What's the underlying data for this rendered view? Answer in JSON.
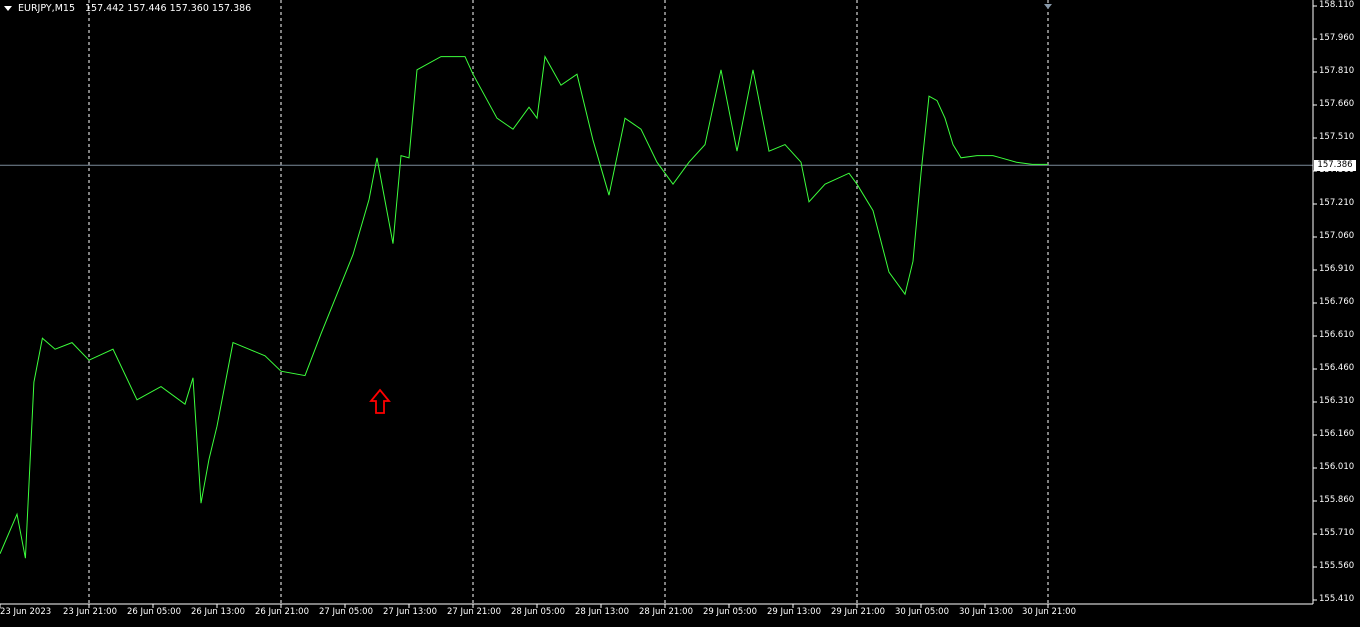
{
  "info": {
    "symbol": "EURJPY,M15",
    "ohlc": "157.442 157.446 157.360 157.386"
  },
  "colors": {
    "background": "#000000",
    "line": "#3cff3c",
    "grid": "#ffffff",
    "price_line": "#7a8a99",
    "arrow": "#ff0000"
  },
  "arrow_icon": "up-arrow-icon",
  "chart_data": {
    "type": "line",
    "current_price": "157.386",
    "y_ticks": [
      "158.110",
      "157.960",
      "157.810",
      "157.660",
      "157.510",
      "157.360",
      "157.210",
      "157.060",
      "156.910",
      "156.760",
      "156.610",
      "156.460",
      "156.310",
      "156.160",
      "156.010",
      "155.860",
      "155.710",
      "155.560",
      "155.410"
    ],
    "x_ticks": [
      "23 Jun 2023",
      "23 Jun 21:00",
      "26 Jun 05:00",
      "26 Jun 13:00",
      "26 Jun 21:00",
      "27 Jun 05:00",
      "27 Jun 13:00",
      "27 Jun 21:00",
      "28 Jun 05:00",
      "28 Jun 13:00",
      "28 Jun 21:00",
      "29 Jun 05:00",
      "29 Jun 13:00",
      "29 Jun 21:00",
      "30 Jun 05:00",
      "30 Jun 13:00",
      "30 Jun 21:00"
    ],
    "ylim": [
      155.41,
      158.11
    ],
    "grid": "vertical dashed at day separators",
    "series": [
      {
        "x": [
          "23 Jun 2023",
          "23 Jun 04:00",
          "23 Jun 06:00",
          "23 Jun 08:00",
          "23 Jun 10:00",
          "23 Jun 13:00",
          "23 Jun 17:00",
          "23 Jun 21:00",
          "26 Jun 00:00",
          "26 Jun 03:00",
          "26 Jun 06:00",
          "26 Jun 09:00",
          "26 Jun 10:00",
          "26 Jun 11:00",
          "26 Jun 12:00",
          "26 Jun 13:00",
          "26 Jun 15:00",
          "26 Jun 17:00",
          "26 Jun 19:00",
          "26 Jun 21:00",
          "27 Jun 00:00",
          "27 Jun 02:00",
          "27 Jun 04:00",
          "27 Jun 06:00",
          "27 Jun 08:00",
          "27 Jun 09:00",
          "27 Jun 11:00",
          "27 Jun 12:00",
          "27 Jun 13:00",
          "27 Jun 14:00",
          "27 Jun 17:00",
          "27 Jun 20:00",
          "27 Jun 21:00",
          "28 Jun 00:00",
          "28 Jun 02:00",
          "28 Jun 04:00",
          "28 Jun 05:00",
          "28 Jun 06:00",
          "28 Jun 08:00",
          "28 Jun 10:00",
          "28 Jun 12:00",
          "28 Jun 14:00",
          "28 Jun 16:00",
          "28 Jun 18:00",
          "28 Jun 20:00",
          "28 Jun 22:00",
          "29 Jun 00:00",
          "29 Jun 02:00",
          "29 Jun 04:00",
          "29 Jun 06:00",
          "29 Jun 08:00",
          "29 Jun 10:00",
          "29 Jun 12:00",
          "29 Jun 14:00",
          "29 Jun 15:00",
          "29 Jun 17:00",
          "29 Jun 20:00",
          "29 Jun 21:00",
          "29 Jun 23:00",
          "30 Jun 01:00",
          "30 Jun 03:00",
          "30 Jun 04:00",
          "30 Jun 05:00",
          "30 Jun 06:00",
          "30 Jun 07:00",
          "30 Jun 08:00",
          "30 Jun 09:00",
          "30 Jun 10:00",
          "30 Jun 12:00",
          "30 Jun 14:00",
          "30 Jun 15:00",
          "30 Jun 17:00",
          "30 Jun 19:00",
          "30 Jun 21:00"
        ],
        "y": [
          155.62,
          155.8,
          155.6,
          156.4,
          156.6,
          156.55,
          156.58,
          156.5,
          156.55,
          156.32,
          156.38,
          156.3,
          156.42,
          155.85,
          156.05,
          156.2,
          156.58,
          156.55,
          156.52,
          156.45,
          156.43,
          156.62,
          156.8,
          156.98,
          157.23,
          157.42,
          157.03,
          157.43,
          157.42,
          157.82,
          157.88,
          157.88,
          157.8,
          157.6,
          157.55,
          157.65,
          157.6,
          157.88,
          157.75,
          157.8,
          157.5,
          157.25,
          157.6,
          157.55,
          157.4,
          157.3,
          157.4,
          157.48,
          157.82,
          157.45,
          157.82,
          157.45,
          157.48,
          157.4,
          157.22,
          157.3,
          157.35,
          157.3,
          157.18,
          156.9,
          156.8,
          156.95,
          157.35,
          157.7,
          157.68,
          157.6,
          157.48,
          157.42,
          157.43,
          157.43,
          157.42,
          157.4,
          157.39,
          157.39
        ]
      }
    ]
  }
}
